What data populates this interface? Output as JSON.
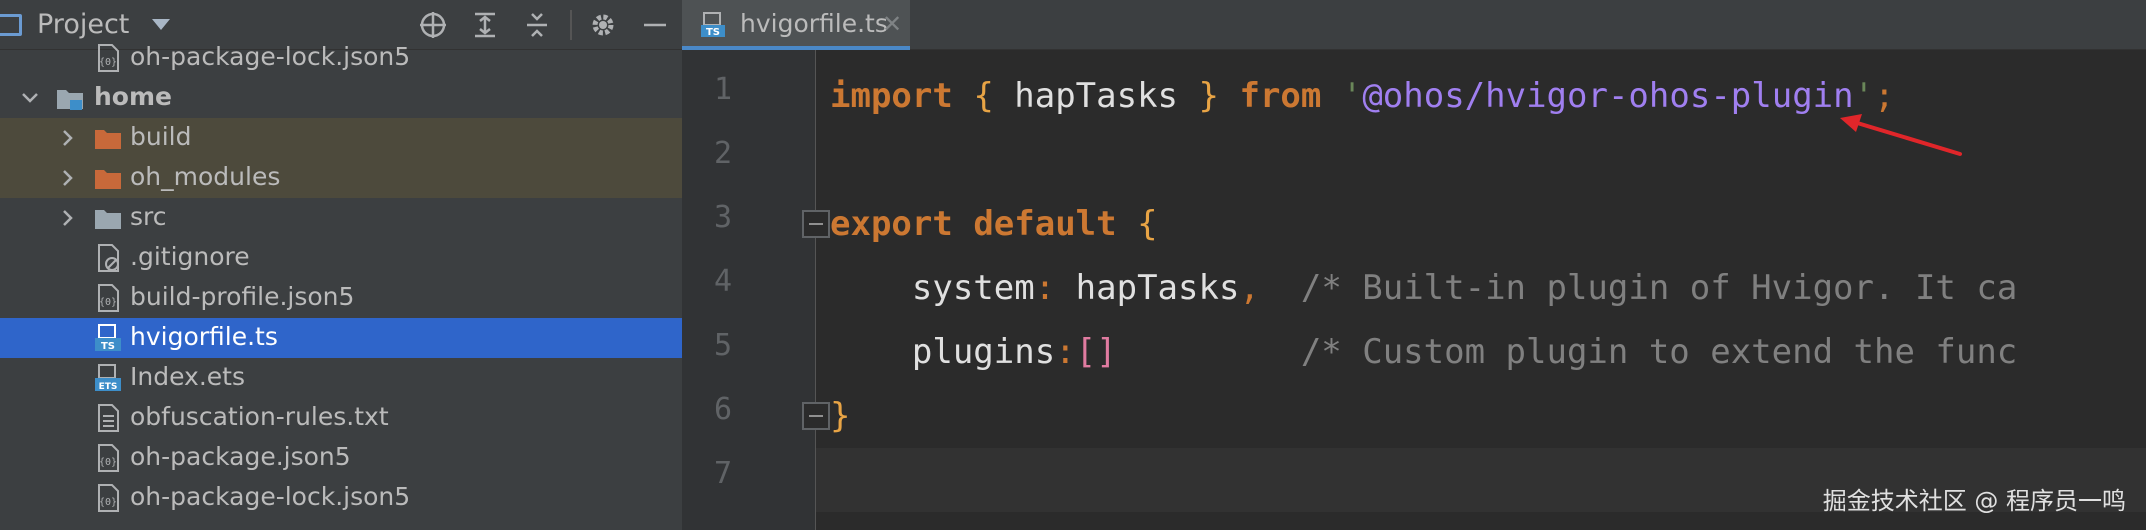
{
  "sidebar": {
    "title": "Project",
    "items": [
      {
        "label": "oh-package-lock.json5",
        "icon": "json-config-icon",
        "indent": 2,
        "chevron": null
      },
      {
        "label": "home",
        "icon": "module-folder-icon",
        "indent": 1,
        "chevron": "down",
        "bold": true
      },
      {
        "label": "build",
        "icon": "orange-folder-icon",
        "indent": 2,
        "chevron": "right",
        "highlight": true
      },
      {
        "label": "oh_modules",
        "icon": "orange-folder-icon",
        "indent": 2,
        "chevron": "right",
        "highlight": true
      },
      {
        "label": "src",
        "icon": "folder-icon",
        "indent": 2,
        "chevron": "right"
      },
      {
        "label": ".gitignore",
        "icon": "gitignore-file-icon",
        "indent": 2,
        "chevron": null
      },
      {
        "label": "build-profile.json5",
        "icon": "json-config-icon",
        "indent": 2,
        "chevron": null
      },
      {
        "label": "hvigorfile.ts",
        "icon": "ts-file-icon",
        "indent": 2,
        "chevron": null,
        "selected": true
      },
      {
        "label": "Index.ets",
        "icon": "ets-file-icon",
        "indent": 2,
        "chevron": null
      },
      {
        "label": "obfuscation-rules.txt",
        "icon": "text-file-icon",
        "indent": 2,
        "chevron": null
      },
      {
        "label": "oh-package.json5",
        "icon": "json-config-icon",
        "indent": 2,
        "chevron": null
      },
      {
        "label": "oh-package-lock.json5",
        "icon": "json-config-icon",
        "indent": 2,
        "chevron": null
      }
    ]
  },
  "editor": {
    "tab_label": "hvigorfile.ts",
    "tab_icon": "ts-file-icon",
    "line_numbers": [
      "1",
      "2",
      "3",
      "4",
      "5",
      "6",
      "7"
    ],
    "lines": [
      [
        {
          "t": "import",
          "c": "kw"
        },
        {
          "t": " ",
          "c": "id"
        },
        {
          "t": "{",
          "c": "br"
        },
        {
          "t": " hapTasks ",
          "c": "id"
        },
        {
          "t": "}",
          "c": "br"
        },
        {
          "t": " ",
          "c": "id"
        },
        {
          "t": "from",
          "c": "kw"
        },
        {
          "t": " ",
          "c": "id"
        },
        {
          "t": "'",
          "c": "str"
        },
        {
          "t": "@ohos/hvigor-ohos-plugin",
          "c": "strp"
        },
        {
          "t": "'",
          "c": "str"
        },
        {
          "t": ";",
          "c": "pu"
        }
      ],
      [],
      [
        {
          "t": "export",
          "c": "kw"
        },
        {
          "t": " ",
          "c": "id"
        },
        {
          "t": "default",
          "c": "kw"
        },
        {
          "t": " ",
          "c": "id"
        },
        {
          "t": "{",
          "c": "br"
        }
      ],
      [
        {
          "t": "    system",
          "c": "id"
        },
        {
          "t": ":",
          "c": "pu"
        },
        {
          "t": " hapTasks",
          "c": "id"
        },
        {
          "t": ",",
          "c": "pu"
        },
        {
          "t": "  /* Built-in plugin of Hvigor. It ca",
          "c": "cm"
        }
      ],
      [
        {
          "t": "    plugins",
          "c": "id"
        },
        {
          "t": ":",
          "c": "pu"
        },
        {
          "t": "[]",
          "c": "pk"
        },
        {
          "t": "         /* Custom plugin to extend the func",
          "c": "cm"
        }
      ],
      [
        {
          "t": "}",
          "c": "br"
        }
      ],
      []
    ]
  },
  "watermark": "掘金技术社区 @ 程序员一鸣",
  "colors": {
    "selection": "#2f65ca",
    "keyword": "#cc7832",
    "string_path": "#a07ff0",
    "comment": "#808080",
    "arrow": "#e0262a"
  }
}
